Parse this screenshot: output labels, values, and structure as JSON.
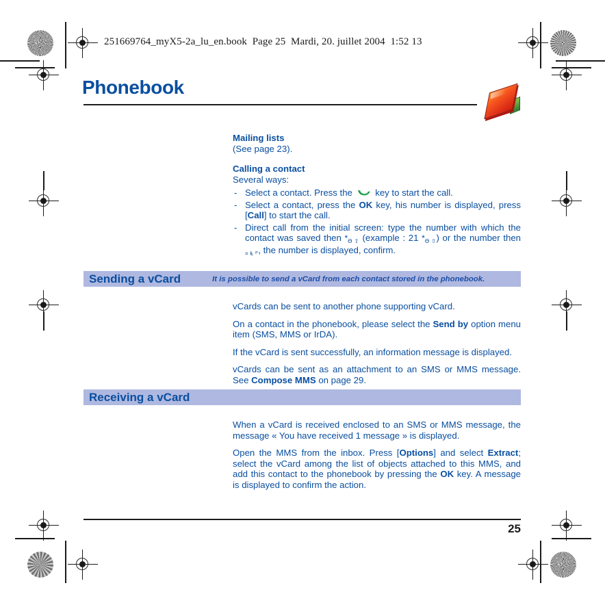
{
  "print_header": {
    "file_line": "251669764_myX5-2a_lu_en.book  Page 25  Mardi, 20. juillet 2004  1:52 13"
  },
  "header": {
    "title": "Phonebook",
    "icon": "phonebook-book-icon"
  },
  "content": {
    "mailing_lists": {
      "heading": "Mailing lists",
      "text": "(See page 23)."
    },
    "calling_a_contact": {
      "heading": "Calling a contact",
      "intro": "Several ways:",
      "bullets": [
        {
          "dash": "-",
          "before_icon": "Select a contact. Press the",
          "icon": "green-handset-icon",
          "after_icon": "key to start the call."
        },
        {
          "dash": "-",
          "part1": "Select a contact, press the ",
          "bold1": "OK",
          "part2": " key, his number is displayed, press [",
          "bold2": "Call",
          "part3": "] to start the call."
        },
        {
          "dash": "-",
          "part1": "Direct call from the initial screen: type the number with which the contact was saved then ",
          "key1": "*",
          "key1_sub": "ϴ ⇧",
          "part2": " (example : 21 ",
          "key2": "*",
          "key2_sub": "ϴ ⇧",
          "part3": ") or the number then ",
          "key3_sub": "⌗ Ⱡ ᴾ",
          "part4": ", the number is displayed, confirm."
        }
      ]
    },
    "sending_vcard": {
      "band_title": "Sending a vCard",
      "band_note": "It is possible to send a vCard from each contact stored in the phonebook.",
      "paragraphs": [
        {
          "type": "plain",
          "text": "vCards can be sent to another phone supporting vCard."
        },
        {
          "type": "rich",
          "part1": "On a contact in the phonebook, please select the ",
          "bold1": "Send by",
          "part2": " option menu item (SMS, MMS or IrDA)."
        },
        {
          "type": "plain",
          "text": "If the vCard is sent successfully, an information message is displayed."
        },
        {
          "type": "rich",
          "part1": "vCards can be sent as an attachment to an SMS or MMS message. See ",
          "bold1": "Compose MMS",
          "part2": " on page 29."
        }
      ]
    },
    "receiving_vcard": {
      "band_title": "Receiving a vCard",
      "band_note": "",
      "paragraphs": [
        {
          "type": "plain",
          "text": "When a vCard is received enclosed to an SMS or MMS message, the message « You have received 1 message » is displayed."
        },
        {
          "type": "rich2",
          "part1": "Open the MMS from the inbox. Press [",
          "bold1": "Options",
          "part2": "] and select ",
          "bold2": "Extract",
          "part3": "; select the vCard among the list of objects attached to this MMS, and add this contact to the phonebook by pressing the ",
          "bold3": "OK",
          "part4": " key. A message is displayed to confirm the action."
        }
      ]
    }
  },
  "footer": {
    "page_number": "25"
  },
  "colors": {
    "heading_blue": "#0A4FA0",
    "band_background": "#AFB8E0",
    "handset_green": "#1E9E45",
    "rule_black": "#1C1C1C"
  }
}
